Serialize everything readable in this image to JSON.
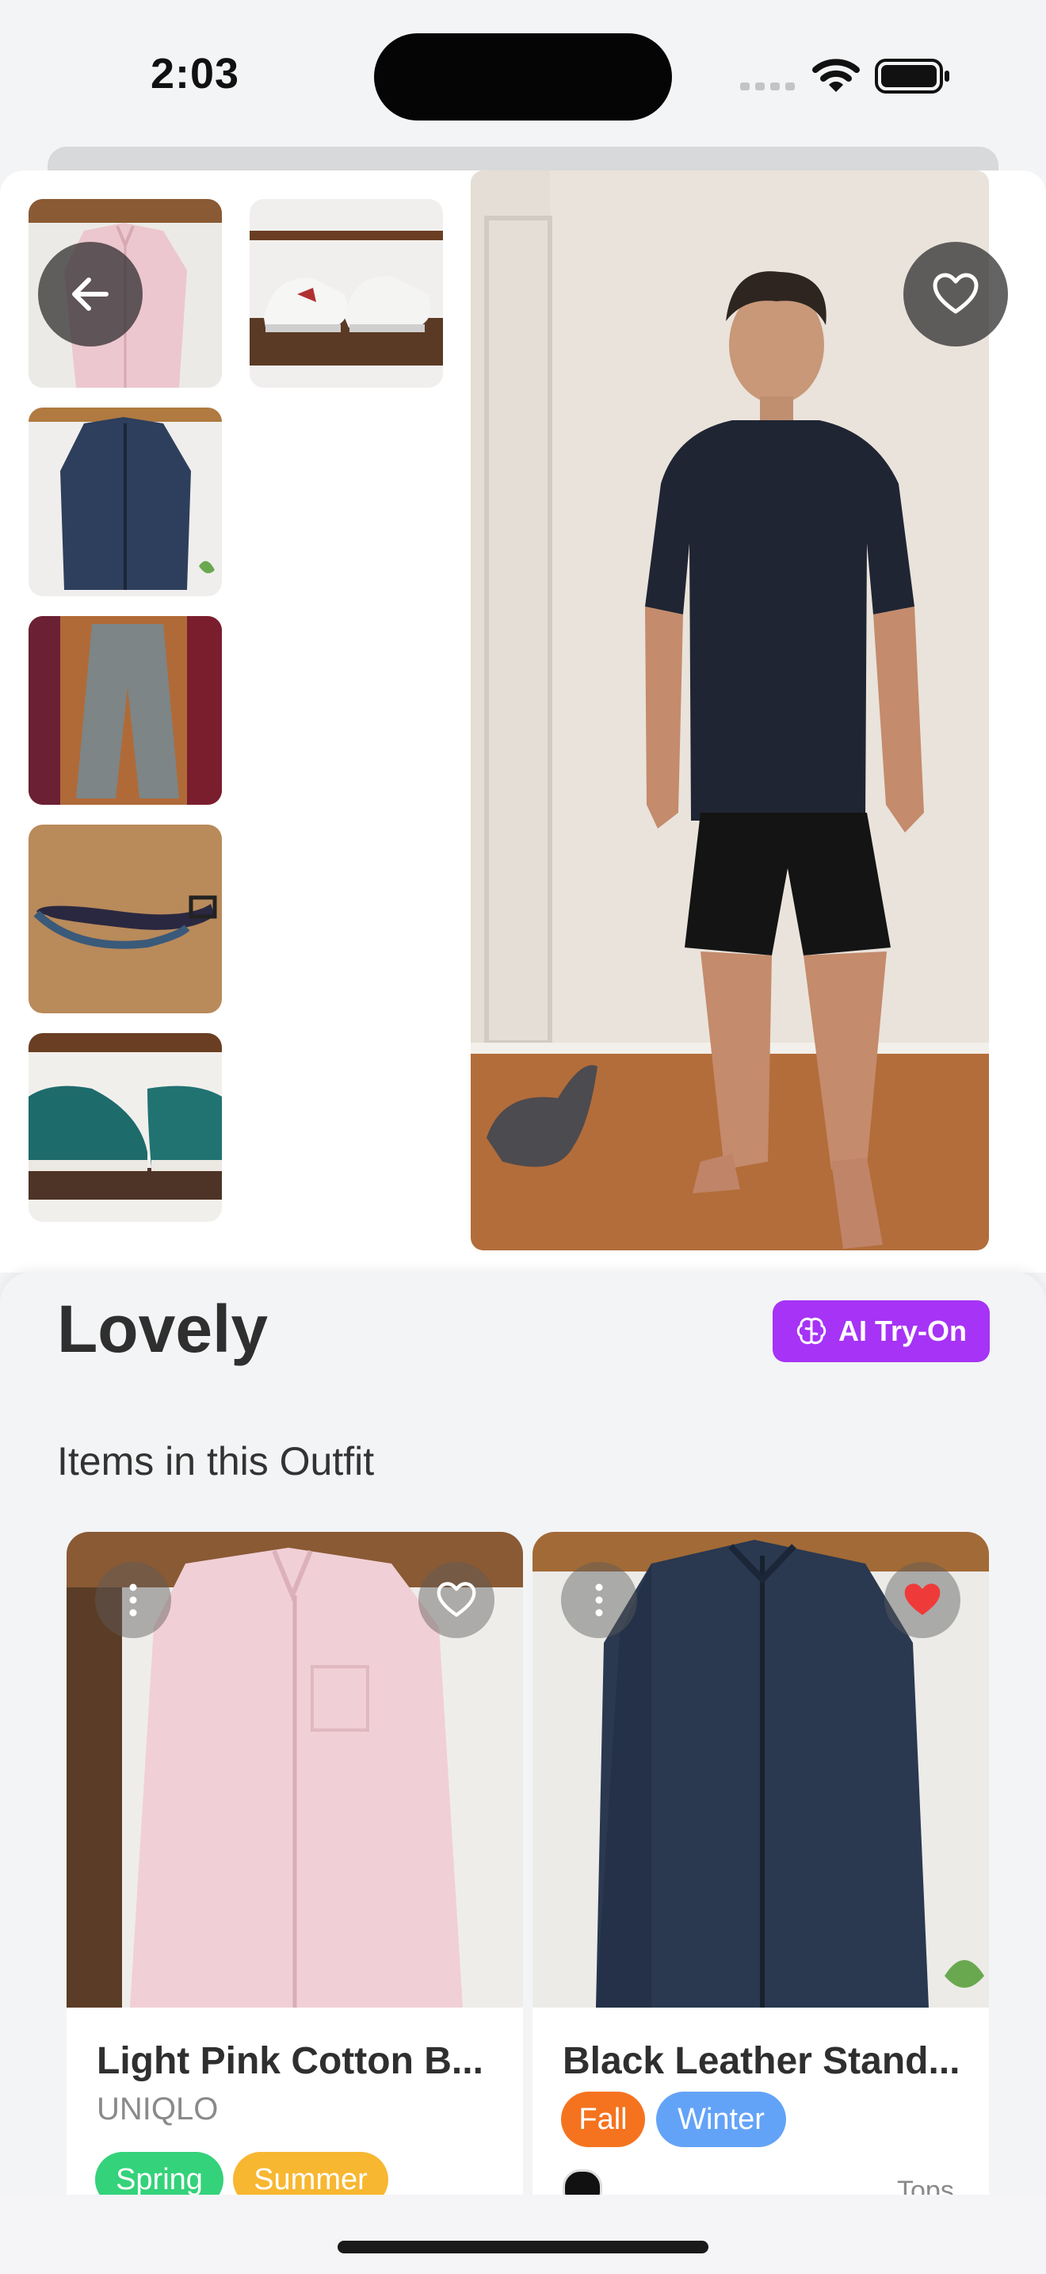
{
  "status_bar": {
    "time": "2:03"
  },
  "outfit": {
    "name": "Lovely",
    "try_on_label": "AI Try-On",
    "favorite": false
  },
  "section": {
    "items_title": "Items in this Outfit"
  },
  "items": [
    {
      "name": "Light Pink Cotton B...",
      "brand": "UNIQLO",
      "tags": [
        "Spring",
        "Summer"
      ],
      "favorite": false
    },
    {
      "name": "Black Leather Stand...",
      "brand": "",
      "tags": [
        "Fall",
        "Winter"
      ],
      "type": "Tops",
      "favorite": true
    }
  ],
  "colors": {
    "accent": "#a633f5",
    "spring": "#34d27a",
    "summer": "#f7b731",
    "fall": "#f5731f",
    "winter": "#63a3f7",
    "favorite_red": "#ef3a3a"
  },
  "icons": {
    "back": "arrow-left-icon",
    "favorite": "heart-icon",
    "try_on": "brain-icon",
    "more": "more-vertical-icon"
  }
}
